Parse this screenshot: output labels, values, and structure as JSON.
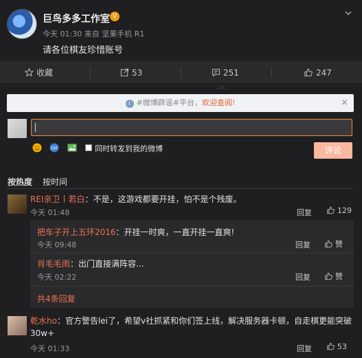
{
  "post": {
    "author": "巨鸟多多工作室",
    "meta": "今天 01:30 来自 坚果手机 R1",
    "text": "请各位棋友珍惜账号"
  },
  "actions": {
    "favorite": "收藏",
    "forward": "53",
    "comment": "251",
    "like": "247"
  },
  "notice": {
    "prefix": "#微博辟谣#平台，",
    "highlight": "欢迎查阅!",
    "close": "×"
  },
  "composer": {
    "forward_label": "同时转发到我的微博",
    "submit": "评论"
  },
  "sort": {
    "hot": "按热度",
    "time": "按时间"
  },
  "comments": [
    {
      "name": "REI亲卫丨若白",
      "text": "：不是，这游戏都要开挂，怕不是个残废。",
      "time": "今天 01:48",
      "reply": "回复",
      "likes": "129"
    },
    {
      "name": "乾水ho",
      "text1": "：官方警告lei了，希望v社抓紧和你们签上线，解决服务器卡顿，自走棋更能突破",
      "text2": "30w+",
      "time": "今天 01:33",
      "reply": "回复",
      "likes": "53"
    }
  ],
  "replies": [
    {
      "name": "把车子开上五环2016",
      "text": "：开挂一时爽，一直开挂一直爽!",
      "time": "今天 09:48",
      "reply": "回复",
      "like": "赞"
    },
    {
      "name": "肖毛毛雨",
      "text": "：出门直接满阵容...",
      "time": "今天 02:22",
      "reply": "回复",
      "like": "赞"
    }
  ],
  "more_replies": "共4条回复"
}
